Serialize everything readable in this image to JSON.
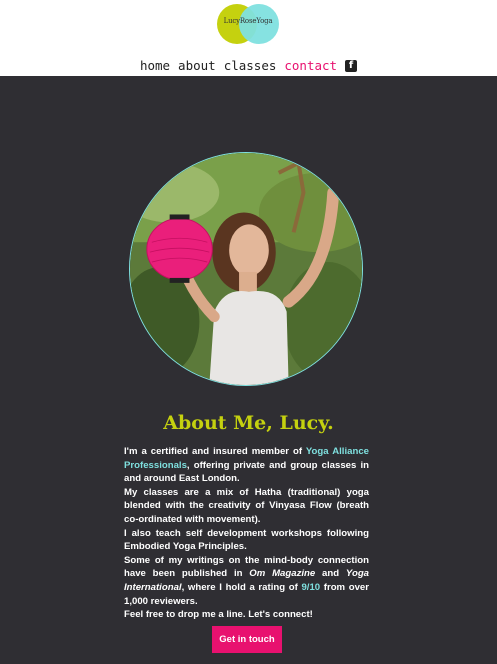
{
  "logo": {
    "text": "LucyRoseYoga"
  },
  "nav": [
    {
      "label": "home"
    },
    {
      "label": "about"
    },
    {
      "label": "classes"
    },
    {
      "label": "contact"
    }
  ],
  "nav_icon": "facebook-icon",
  "colors": {
    "accent_pink": "#e8116f",
    "accent_lime": "#c5d10f",
    "accent_cyan": "#7fe0df",
    "background": "#2f2e33"
  },
  "hero": {
    "image": "portrait with pink paper lantern"
  },
  "about": {
    "heading": "About Me, Lucy.",
    "p1_a": "I'm a certified and insured member of ",
    "p1_link": "Yoga Alliance Professionals",
    "p1_b": ", offering private and group classes in and around East London.",
    "p2": "My classes are a mix of Hatha (traditional) yoga blended with the creativity of Vinyasa Flow (breath co-ordinated with movement).",
    "p3": "I also teach self development workshops following Embodied Yoga Principles.",
    "p4_a": "Some of my writings on the mind-body connection have been published in ",
    "p4_mag1": "Om Magazine",
    "p4_and": " and ",
    "p4_mag2": "Yoga International",
    "p4_b": ", where I hold a rating of ",
    "p4_rating": "9/10",
    "p4_c": " from over 1,000 reviewers.",
    "p5": "Feel free to drop me a line. Let's connect!"
  },
  "cta": {
    "label": "Get in touch"
  }
}
